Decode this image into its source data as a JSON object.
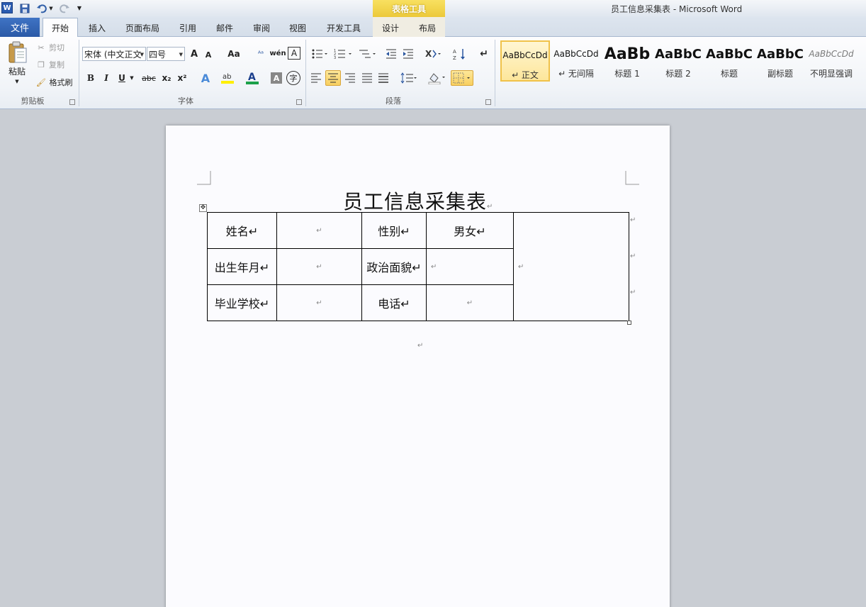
{
  "titlebar": {
    "app_icon": "W",
    "contextual_tab_group": "表格工具",
    "window_title": "员工信息采集表 - Microsoft Word"
  },
  "tabs": {
    "file": "文件",
    "items": [
      "开始",
      "插入",
      "页面布局",
      "引用",
      "邮件",
      "审阅",
      "视图",
      "开发工具",
      "设计",
      "布局"
    ],
    "active": "开始"
  },
  "ribbon": {
    "clipboard": {
      "paste": "粘贴",
      "cut": "剪切",
      "copy": "复制",
      "format_painter": "格式刷",
      "label": "剪贴板"
    },
    "font": {
      "font_name": "宋体 (中文正文",
      "font_size": "四号",
      "grow": "A",
      "shrink": "A",
      "change_case": "Aa",
      "bold": "B",
      "italic": "I",
      "underline": "U",
      "strike": "abc",
      "subscript": "x₂",
      "superscript": "x²",
      "label": "字体"
    },
    "paragraph": {
      "label": "段落"
    },
    "styles": [
      {
        "sample": "AaBbCcDd",
        "name": "↵ 正文"
      },
      {
        "sample": "AaBbCcDd",
        "name": "↵ 无间隔"
      },
      {
        "sample": "AaBb",
        "name": "标题 1"
      },
      {
        "sample": "AaBbC",
        "name": "标题 2"
      },
      {
        "sample": "AaBbC",
        "name": "标题"
      },
      {
        "sample": "AaBbC",
        "name": "副标题"
      },
      {
        "sample": "AaBbCcDd",
        "name": "不明显强调"
      }
    ]
  },
  "document": {
    "title": "员工信息采集表",
    "table": {
      "rows": [
        [
          "姓名↵",
          "↵",
          "性别↵",
          "男女↵"
        ],
        [
          "出生年月↵",
          "↵",
          "政治面貌↵",
          "↵"
        ],
        [
          "毕业学校↵",
          "↵",
          "电话↵",
          "↵"
        ]
      ],
      "photo_cell": "↵"
    }
  },
  "colors": {
    "file_tab": "#2b5aa7",
    "contextual_accent": "#ecc93a",
    "workspace": "#c9cdd3"
  }
}
